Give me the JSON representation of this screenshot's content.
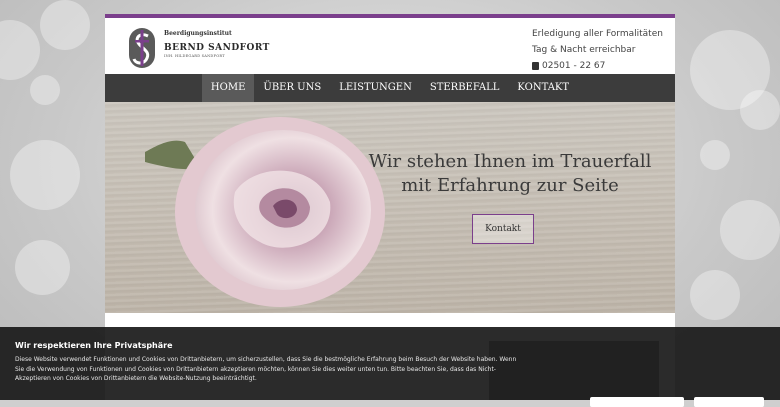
{
  "logo": {
    "small": "Beerdigungsinstitut",
    "name": "BERND SANDFORT",
    "sub": "INH. HILDEGARD SANDFORT"
  },
  "contact": {
    "line1": "Erledigung aller Formalitäten",
    "line2": "Tag & Nacht erreichbar",
    "phone": "02501 - 22 67"
  },
  "nav": [
    {
      "label": "HOME"
    },
    {
      "label": "ÜBER UNS"
    },
    {
      "label": "LEISTUNGEN"
    },
    {
      "label": "STERBEFALL"
    },
    {
      "label": "KONTAKT"
    }
  ],
  "hero": {
    "title_line1": "Wir stehen Ihnen im Trauerfall",
    "title_line2": "mit Erfahrung zur Seite",
    "button": "Kontakt"
  },
  "cookie": {
    "title": "Wir respektieren Ihre Privatsphäre",
    "text": "Diese Website verwendet Funktionen und Cookies von Drittanbietern, um sicherzustellen, dass Sie die bestmögliche Erfahrung beim Besuch der Website haben. Wenn Sie die Verwendung von Funktionen und Cookies von Drittanbietern akzeptieren möchten, können Sie dies weiter unten tun. Bitte beachten Sie, dass das Nicht-Akzeptieren von Cookies von Drittanbietern die Website-Nutzung beeinträchtigt."
  },
  "colors": {
    "accent": "#7b3f8c",
    "nav_bg": "#3c3c3c"
  }
}
